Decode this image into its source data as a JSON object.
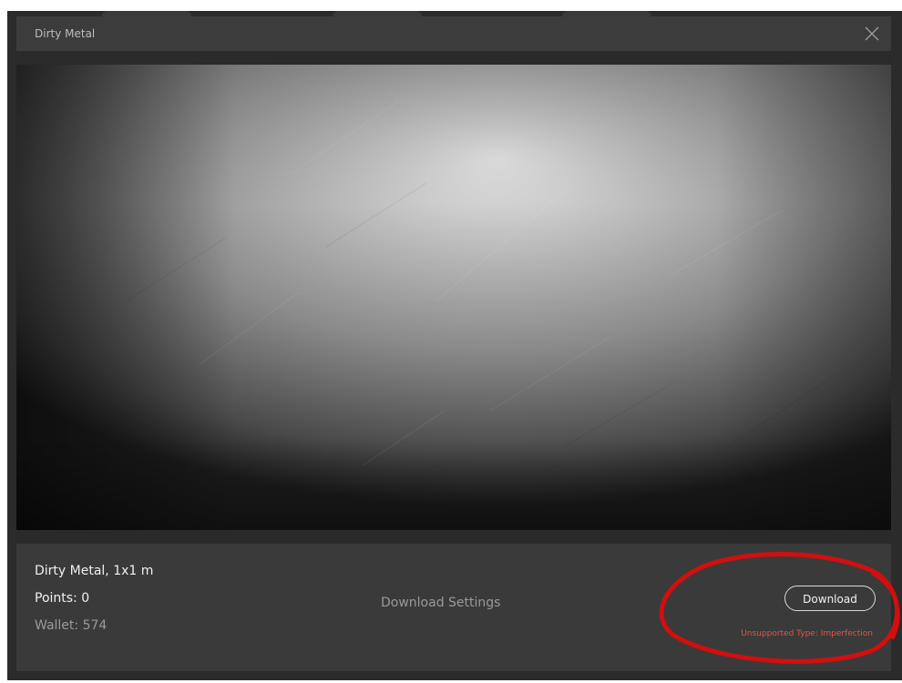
{
  "window": {
    "title": "Dirty Metal",
    "close_icon": "close-icon"
  },
  "asset": {
    "name_size": "Dirty Metal, 1x1 m",
    "points": "Points: 0",
    "wallet": "Wallet: 574"
  },
  "actions": {
    "download_settings_label": "Download Settings",
    "download_label": "Download",
    "error_text": "Unsupported Type: Imperfection"
  },
  "colors": {
    "modal_bg": "#3a3a3a",
    "error": "#e05646",
    "annotation": "#d10f0f"
  }
}
